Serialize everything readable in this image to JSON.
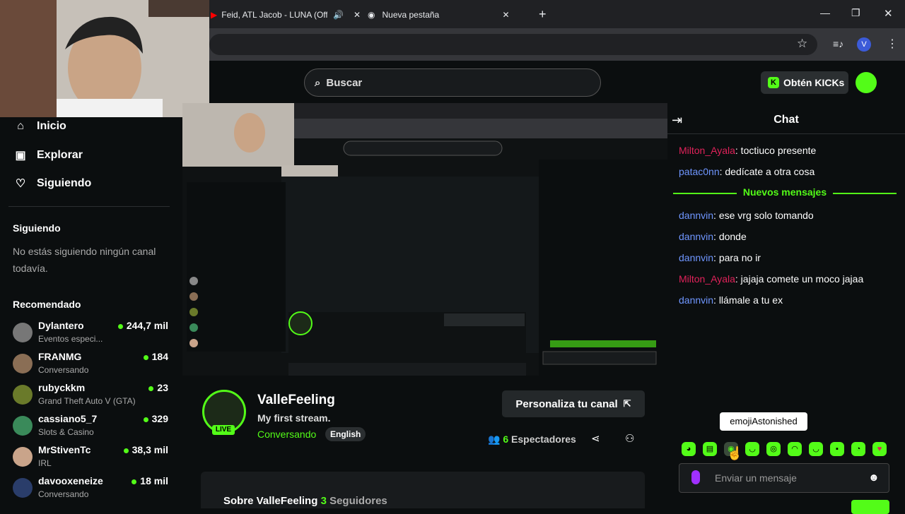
{
  "browser": {
    "tabs": [
      {
        "label": "Feid, ATL Jacob - LUNA (Off"
      },
      {
        "label": "Nueva pestaña"
      }
    ],
    "new_tab": "+",
    "profile_initial": "V"
  },
  "header": {
    "search_placeholder": "Buscar",
    "kicks_label": "Obtén KICKs"
  },
  "sidebar": {
    "nav": [
      {
        "label": "Inicio"
      },
      {
        "label": "Explorar"
      },
      {
        "label": "Siguiendo"
      }
    ],
    "following_title": "Siguiendo",
    "following_empty": "No estás siguiendo ningún canal todavía.",
    "recommended_title": "Recomendado",
    "recommended": [
      {
        "name": "Dylantero",
        "category": "Eventos especi...",
        "viewers": "244,7 mil"
      },
      {
        "name": "FRANMG",
        "category": "Conversando",
        "viewers": "184"
      },
      {
        "name": "rubyckkm",
        "category": "Grand Theft Auto V (GTA)",
        "viewers": "23"
      },
      {
        "name": "cassiano5_7",
        "category": "Slots & Casino",
        "viewers": "329"
      },
      {
        "name": "MrStivenTc",
        "category": "IRL",
        "viewers": "38,3 mil"
      },
      {
        "name": "davooxeneize",
        "category": "Conversando",
        "viewers": "18 mil"
      }
    ]
  },
  "channel": {
    "name": "ValleFeeling",
    "stream_title": "My first stream.",
    "category": "Conversando",
    "language": "English",
    "live": "LIVE",
    "customize": "Personaliza tu canal",
    "viewers_count": "6",
    "viewers_label": "Espectadores",
    "about": "Sobre ValleFeeling",
    "followers_count": "3",
    "followers_label": "Seguidores"
  },
  "chat": {
    "title": "Chat",
    "new_messages": "Nuevos mensajes",
    "messages": [
      {
        "user": "Milton_Ayala",
        "text": ": toctiuco presente"
      },
      {
        "user": "patac0nn",
        "text": ": dedícate a otra cosa"
      },
      {
        "user": "dannvin",
        "text": ": ese vrg solo tomando"
      },
      {
        "user": "dannvin",
        "text": ": donde"
      },
      {
        "user": "dannvin",
        "text": ": para no ir"
      },
      {
        "user": "Milton_Ayala",
        "text": ": jajaja comete un moco jajaa"
      },
      {
        "user": "dannvin",
        "text": ": llámale a tu ex"
      }
    ],
    "tooltip": "emojiAstonished",
    "input_placeholder": "Enviar un mensaje"
  },
  "colors": {
    "accent": "#53fc18",
    "bg": "#0b0e0f",
    "user_red": "#e0225a",
    "user_blue": "#6f96ff"
  }
}
